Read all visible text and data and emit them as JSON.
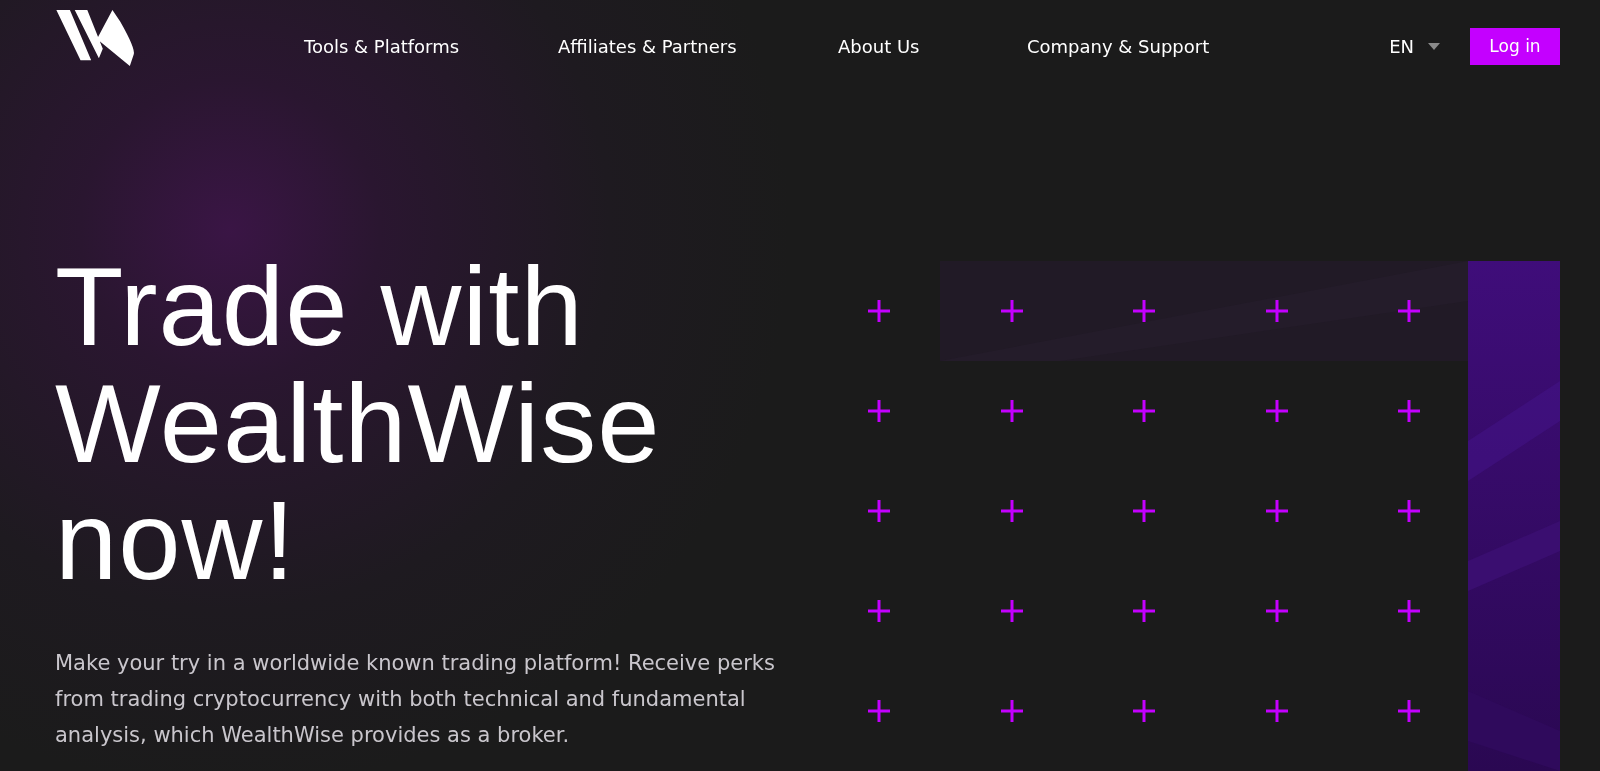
{
  "nav": {
    "items": [
      {
        "label": "Tools & Platforms"
      },
      {
        "label": "Affiliates & Partners"
      },
      {
        "label": "About Us"
      },
      {
        "label": "Company & Support"
      }
    ],
    "language": "EN",
    "login": "Log in"
  },
  "hero": {
    "heading": "Trade with WealthWise now!",
    "text": "Make your try in a worldwide known trading platform! Receive perks from trading cryptocurrency with both technical and fundamental analysis, which WealthWise provides as a broker."
  }
}
